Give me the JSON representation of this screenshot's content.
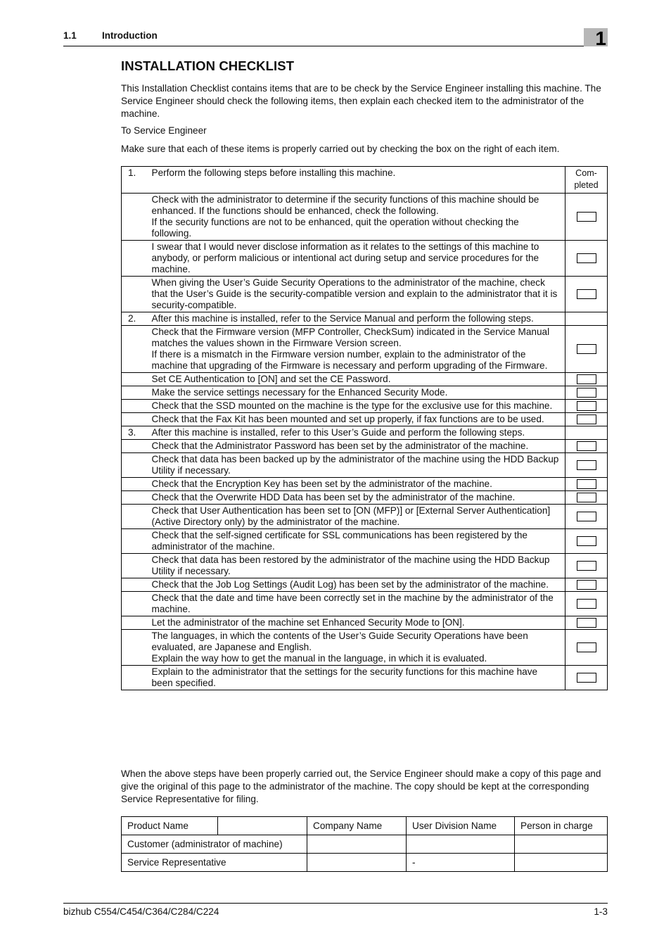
{
  "header": {
    "section_number": "1.1",
    "section_title": "Introduction",
    "chapter_number": "1"
  },
  "title": "INSTALLATION CHECKLIST",
  "intro": {
    "paragraph1": "This Installation Checklist contains items that are to be check by the Service Engineer installing this machine. The Service Engineer should check the following items, then explain each checked item to the administrator of the machine.",
    "paragraph2": "To Service Engineer",
    "paragraph3": "Make sure that each of these items is properly carried out by checking the box on the right of each item."
  },
  "checklist": {
    "completed_header": "Com-\npleted",
    "rows": [
      {
        "type": "step",
        "number": "1.",
        "text": "Perform the following steps before installing this machine."
      },
      {
        "type": "item",
        "text": "Check with the administrator to determine if the security functions of this machine should be enhanced. If the functions should be enhanced, check the following.\nIf the security functions are not to be enhanced, quit the operation without checking the following.",
        "checked": false
      },
      {
        "type": "item",
        "text": "I swear that I would never disclose information as it relates to the settings of this machine to anybody, or perform malicious or intentional act during setup and service procedures for the machine.",
        "checked": false
      },
      {
        "type": "item",
        "text": "When giving the User’s Guide Security Operations to the administrator of the machine, check that the User’s Guide is the security-compatible version and explain to the administrator that it is security-compatible.",
        "checked": false
      },
      {
        "type": "step",
        "number": "2.",
        "text": "After this machine is installed, refer to the Service Manual and perform the following steps."
      },
      {
        "type": "item",
        "text": "Check that the Firmware version (MFP Controller, CheckSum) indicated in the Service Manual matches the values shown in the Firmware Version screen.\nIf there is a mismatch in the Firmware version number, explain to the administrator of the machine that upgrading of the Firmware is necessary and perform upgrading of the Firmware.",
        "checked": false
      },
      {
        "type": "item",
        "text": "Set CE Authentication to [ON] and set the CE Password.",
        "checked": false
      },
      {
        "type": "item",
        "text": "Make the service settings necessary for the Enhanced Security Mode.",
        "checked": false
      },
      {
        "type": "item",
        "text": "Check that the SSD mounted on the machine is the type for the exclusive use for this machine.",
        "checked": false
      },
      {
        "type": "item",
        "text": "Check that the Fax Kit has been mounted and set up properly, if fax functions are to be used.",
        "checked": false
      },
      {
        "type": "step",
        "number": "3.",
        "text": "After this machine is installed, refer to this User’s Guide and perform the following steps."
      },
      {
        "type": "item",
        "text": "Check that the Administrator Password has been set by the administrator of the machine.",
        "checked": false
      },
      {
        "type": "item",
        "text": "Check that data has been backed up by the administrator of the machine using the HDD Backup Utility if necessary.",
        "checked": false
      },
      {
        "type": "item",
        "text": "Check that the Encryption Key has been set by the administrator of the machine.",
        "checked": false
      },
      {
        "type": "item",
        "text": "Check that the Overwrite HDD Data has been set by the administrator of the machine.",
        "checked": false
      },
      {
        "type": "item",
        "text": "Check that User Authentication has been set to [ON (MFP)] or [External Server Authentication] (Active Directory only) by the administrator of the machine.",
        "checked": false
      },
      {
        "type": "item",
        "text": "Check that the self-signed certificate for SSL communications has been registered by the administrator of the machine.",
        "checked": false
      },
      {
        "type": "item",
        "text": "Check that data has been restored by the administrator of the machine using the HDD Backup Utility if necessary.",
        "checked": false
      },
      {
        "type": "item",
        "text": "Check that the Job Log Settings (Audit Log) has been set by the administrator of the machine.",
        "checked": false
      },
      {
        "type": "item",
        "text": "Check that the date and time have been correctly set in the machine by the administrator of the machine.",
        "checked": false
      },
      {
        "type": "item",
        "text": "Let the administrator of the machine set Enhanced Security Mode to [ON].",
        "checked": false
      },
      {
        "type": "item",
        "text": "The languages, in which the contents of the User’s Guide Security Operations have been evaluated, are Japanese and English.\nExplain the way how to get the manual in the language, in which it is evaluated.",
        "checked": false
      },
      {
        "type": "item",
        "text": "Explain to the administrator that the settings for the security functions for this machine have been specified.",
        "checked": false
      }
    ]
  },
  "closing_paragraph": "When the above steps have been properly carried out, the Service Engineer should make a copy of this page and give the original of this page to the administrator of the machine. The copy should be kept at the corresponding Service Representative for filing.",
  "sign_table": {
    "header": {
      "product_name_label": "Product Name",
      "product_name_value": "",
      "company_name": "Company Name",
      "user_division_name": "User Division Name",
      "person_in_charge": "Person in charge"
    },
    "rows": [
      {
        "label": "Customer (administrator of machine)",
        "company_name": "",
        "user_division_name": "",
        "person_in_charge": ""
      },
      {
        "label": "Service Representative",
        "company_name": "",
        "user_division_name": "-",
        "person_in_charge": ""
      }
    ]
  },
  "footer": {
    "product": "bizhub C554/C454/C364/C284/C224",
    "page": "1-3"
  }
}
